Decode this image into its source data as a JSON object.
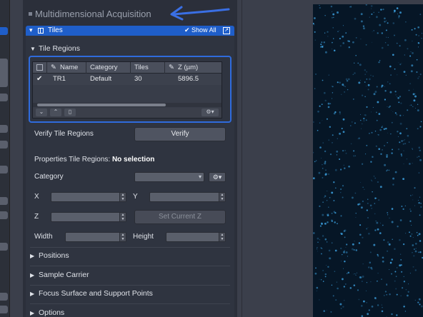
{
  "header": {
    "title": "Multidimensional Acquisition"
  },
  "tiles_panel": {
    "title": "Tiles",
    "show_all_label": "Show All",
    "tile_regions_label": "Tile Regions",
    "table": {
      "columns": [
        "Name",
        "Category",
        "Tiles",
        "Z (µm)"
      ],
      "rows": [
        {
          "checked": true,
          "name": "TR1",
          "category": "Default",
          "tiles": "30",
          "z": "5896.5"
        }
      ]
    },
    "verify_label": "Verify Tile Regions",
    "verify_button": "Verify",
    "properties_label": "Properties Tile Regions:",
    "properties_selection": "No selection",
    "category_label": "Category",
    "x_label": "X",
    "y_label": "Y",
    "z_label": "Z",
    "set_current_z": "Set Current Z",
    "width_label": "Width",
    "height_label": "Height"
  },
  "sections": {
    "positions": "Positions",
    "sample_carrier": "Sample Carrier",
    "focus_surface": "Focus Surface and Support Points",
    "options": "Options"
  },
  "colors": {
    "accent": "#1f5ec9",
    "highlight_frame": "#2f6bdd",
    "image_bg": "#061626",
    "fluorescence": "#3a9bd8"
  }
}
